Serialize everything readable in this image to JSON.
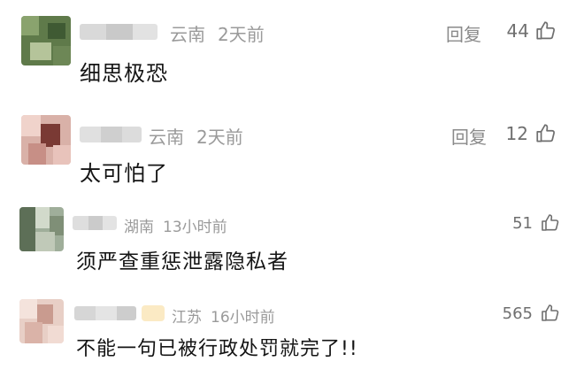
{
  "comments": [
    {
      "location": "云南",
      "time": "2天前",
      "reply_label": "回复",
      "likes": "44",
      "text": "细思极恐",
      "avatar_icon": "blurred-avatar",
      "like_icon": "thumbs-up-icon"
    },
    {
      "location": "云南",
      "time": "2天前",
      "reply_label": "回复",
      "likes": "12",
      "text": "太可怕了",
      "avatar_icon": "blurred-avatar",
      "like_icon": "thumbs-up-icon"
    },
    {
      "location": "湖南",
      "time": "13小时前",
      "likes": "51",
      "text": "须严查重惩泄露隐私者",
      "avatar_icon": "blurred-avatar",
      "like_icon": "thumbs-up-icon"
    },
    {
      "location": "江苏",
      "time": "16小时前",
      "likes": "565",
      "text": "不能一句已被行政处罚就完了!!",
      "avatar_icon": "blurred-avatar",
      "like_icon": "thumbs-up-icon"
    }
  ],
  "colors": {
    "meta_text": "#9a9a9a",
    "body_text": "#141414",
    "badge": "#fbeac4"
  }
}
